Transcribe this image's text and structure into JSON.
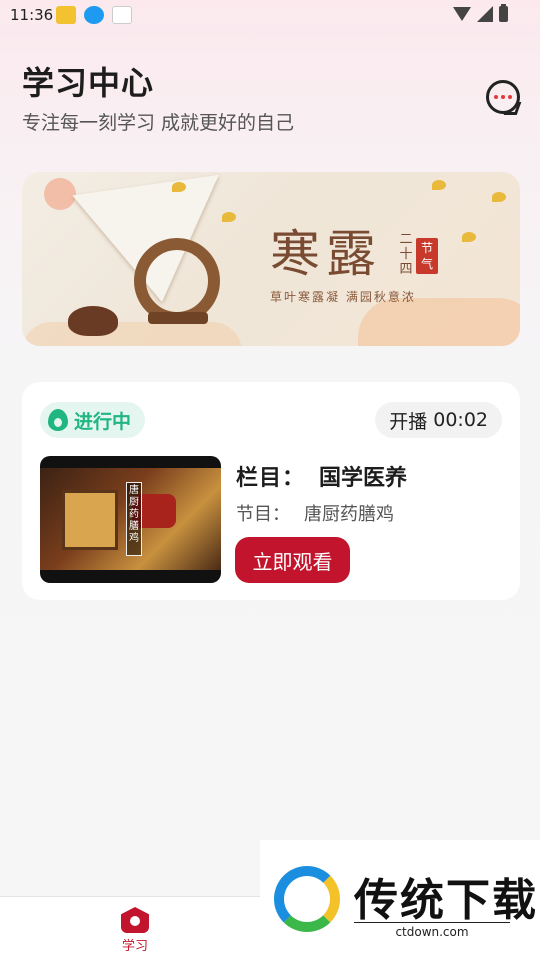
{
  "status_bar": {
    "time": "11:36",
    "icons": [
      "app-icon",
      "download-icon",
      "app-icon",
      "wifi-icon",
      "signal-icon",
      "battery-icon"
    ]
  },
  "header": {
    "title": "学习中心",
    "subtitle": "专注每一刻学习 成就更好的自己",
    "message_icon": "message-dots-icon"
  },
  "banner": {
    "title": "寒露",
    "vertical_text": "二十四",
    "seal_text": "节气",
    "caption": "草叶寒露凝 满园秋意浓"
  },
  "live_card": {
    "status": "进行中",
    "status_icon": "flame-icon",
    "broadcast_label": "开播",
    "broadcast_time": "00:02",
    "thumbnail_text": "唐厨药膳鸡",
    "column_label": "栏目：",
    "column_value": "国学医养",
    "episode_label": "节目：",
    "episode_value": "唐厨药膳鸡",
    "watch_button": "立即观看"
  },
  "bottom_nav": {
    "items": [
      {
        "label": "学习",
        "icon": "home-icon",
        "active": true
      }
    ]
  },
  "watermark": {
    "title": "传统下载",
    "url": "ctdown.com"
  },
  "colors": {
    "accent_red": "#c2152d",
    "live_green": "#1fb682"
  }
}
